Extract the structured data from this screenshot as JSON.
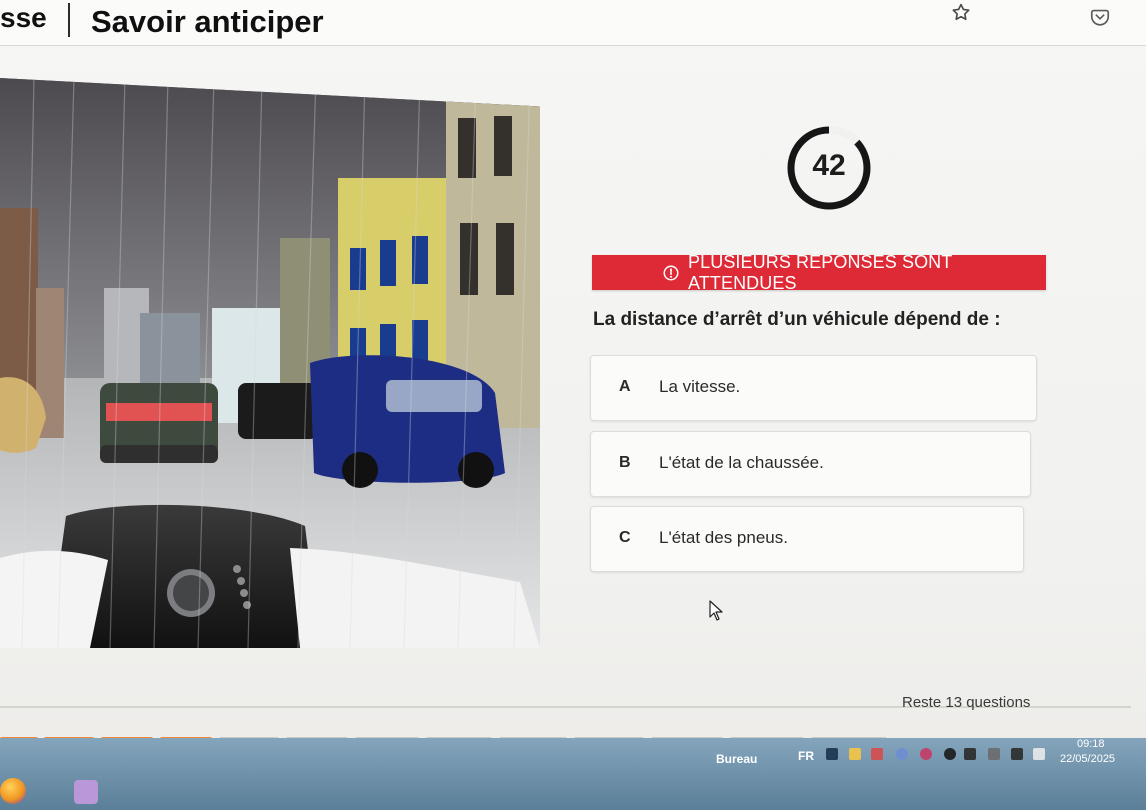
{
  "header": {
    "breadcrumb_prefix": "sse",
    "title": "Savoir anticiper"
  },
  "browser_actions": {
    "star_icon": "star-icon",
    "pocket_icon": "pocket-icon"
  },
  "quiz": {
    "timer_value": "42",
    "alert": "PLUSIEURS RÉPONSES SONT ATTENDUES",
    "question": "La distance d’arrêt d’un véhicule dépend de :",
    "answers": [
      {
        "letter": "A",
        "text": "La vitesse."
      },
      {
        "letter": "B",
        "text": "L'état de la chaussée."
      },
      {
        "letter": "C",
        "text": "L'état des pneus."
      }
    ],
    "remaining": "Reste 13 questions"
  },
  "taskbar": {
    "label": "Bureau",
    "lang": "FR",
    "time": "09:18",
    "date": "22/05/2025"
  },
  "colors": {
    "alert": "#dd2a36",
    "progress_done": "#f08a3a",
    "progress_todo": "#c8c8c5"
  }
}
